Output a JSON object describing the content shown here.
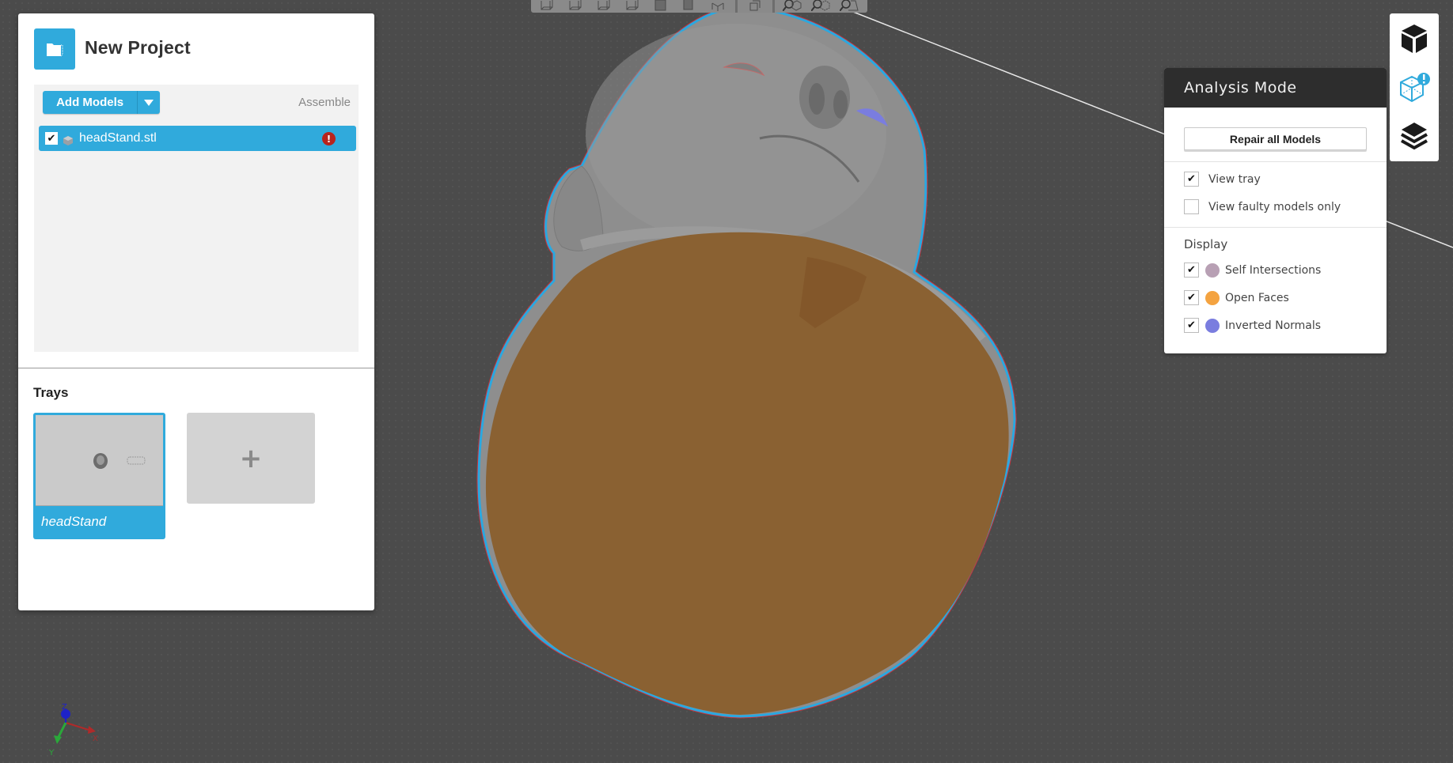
{
  "project": {
    "title": "New Project",
    "icon": "folder-icon",
    "add_models_label": "Add Models",
    "assemble_label": "Assemble",
    "models": [
      {
        "name": "headStand.stl",
        "checked": true,
        "status": "error",
        "status_glyph": "!"
      }
    ]
  },
  "trays": {
    "title": "Trays",
    "items": [
      {
        "label": "headStand",
        "selected": true
      }
    ],
    "add_glyph": "+"
  },
  "view_toolbar": {
    "buttons": [
      "view-front-icon",
      "view-back-icon",
      "view-left-icon",
      "view-right-icon",
      "view-top-icon",
      "view-bottom-icon",
      "view-iso-icon",
      "view-perspective-icon",
      "zoom-selection-icon",
      "zoom-all-icon",
      "zoom-fit-icon"
    ]
  },
  "right_toolbar": {
    "buttons": [
      {
        "name": "model-view-icon"
      },
      {
        "name": "analysis-mode-icon",
        "active": true,
        "badge": "!"
      },
      {
        "name": "layers-icon"
      }
    ]
  },
  "analysis": {
    "title": "Analysis Mode",
    "repair_label": "Repair all Models",
    "options": [
      {
        "label": "View tray",
        "checked": true
      },
      {
        "label": "View faulty models only",
        "checked": false
      }
    ],
    "display_label": "Display",
    "display_items": [
      {
        "label": "Self Intersections",
        "checked": true,
        "color": "#b8a0b4"
      },
      {
        "label": "Open Faces",
        "checked": true,
        "color": "#f4a340"
      },
      {
        "label": "Inverted Normals",
        "checked": true,
        "color": "#7a7ddf"
      }
    ]
  },
  "axes": {
    "x": "X",
    "y": "Y",
    "z": "Z"
  },
  "colors": {
    "accent": "#30aadc",
    "error": "#b8231d",
    "background": "#4b4b4b",
    "model_gray": "#8c8c8c",
    "open_faces_overlay": "#8a6132",
    "selection_outline": "#2aa8e0"
  }
}
